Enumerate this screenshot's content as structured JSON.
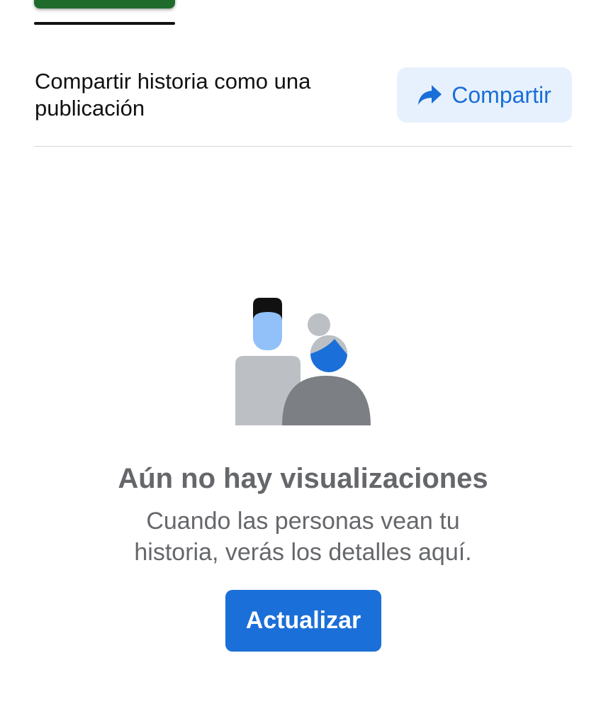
{
  "share_row": {
    "text": "Compartir historia como una publicación",
    "button_label": "Compartir",
    "button_icon": "share-arrow-icon"
  },
  "empty_state": {
    "illustration": "people-illustration",
    "title": "Aún no hay visualizaciones",
    "body_line1": "Cuando las personas vean tu",
    "body_line2": "historia, verás los detalles aquí.",
    "button_label": "Actualizar"
  },
  "colors": {
    "accent": "#1b6fd8",
    "share_button_bg": "#e7f1fd",
    "secondary_text": "#65676b"
  }
}
